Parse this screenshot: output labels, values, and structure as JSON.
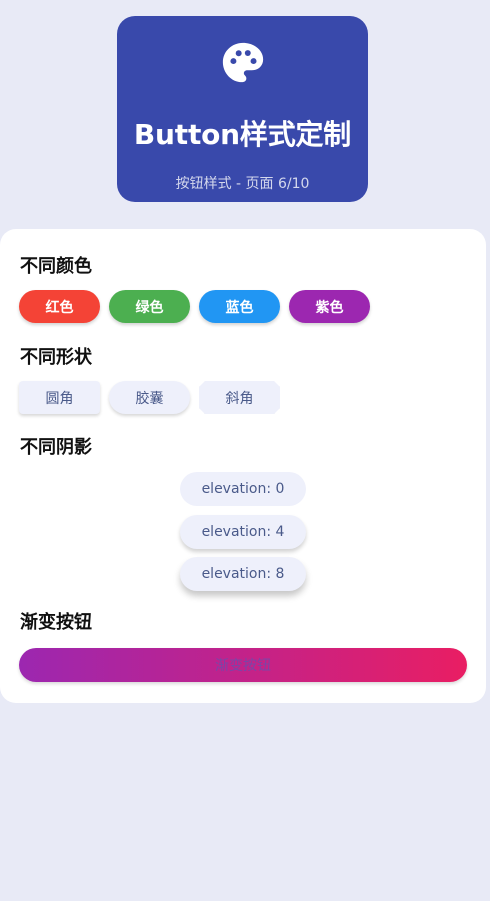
{
  "hero": {
    "icon": "palette-icon",
    "title": "Button样式定制",
    "subtitle": "按钮样式 - 页面 6/10",
    "color": "#3949ab"
  },
  "sections": {
    "colors_title": "不同颜色",
    "shapes_title": "不同形状",
    "shadows_title": "不同阴影",
    "gradient_title": "渐变按钮"
  },
  "color_buttons": [
    {
      "label": "红色",
      "color": "#f44336"
    },
    {
      "label": "绿色",
      "color": "#4caf50"
    },
    {
      "label": "蓝色",
      "color": "#2196f3"
    },
    {
      "label": "紫色",
      "color": "#9c27b0"
    }
  ],
  "shape_buttons": [
    {
      "label": "圆角"
    },
    {
      "label": "胶囊"
    },
    {
      "label": "斜角"
    }
  ],
  "elevation_buttons": [
    {
      "label": "elevation: 0"
    },
    {
      "label": "elevation: 4"
    },
    {
      "label": "elevation: 8"
    }
  ],
  "gradient_button": {
    "label": "渐变按钮",
    "start_color": "#9c27b0",
    "end_color": "#e91e63"
  },
  "colors": {
    "background": "#e8eaf6",
    "card": "#ffffff",
    "secondary_button": "#eef0fb"
  }
}
